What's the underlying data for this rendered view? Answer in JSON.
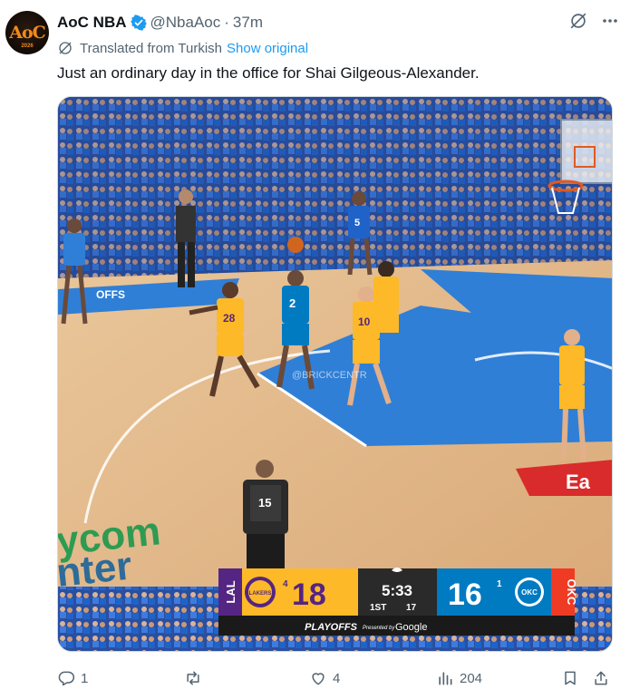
{
  "author": {
    "display_name": "AoC NBA",
    "handle": "@NbaAoc",
    "separator": "·",
    "time": "37m",
    "avatar_text": "AoC",
    "avatar_year": "2026"
  },
  "translation": {
    "label": "Translated from Turkish",
    "show_original": "Show original"
  },
  "tweet": {
    "text": "Just an ordinary day in the office for Shai Gilgeous-Alexander."
  },
  "scoreboard": {
    "away_abbr": "LAL",
    "away_timeouts": "4",
    "away_score": "18",
    "clock": "5:33",
    "period": "1ST",
    "shot_clock": "17",
    "home_score": "16",
    "home_timeouts": "1",
    "home_abbr": "OKC",
    "banner": "PLAYOFFS",
    "sponsor_prefix": "Presented by",
    "sponsor": "Google",
    "away_logo": "LAKERS",
    "home_logo": "OKC",
    "colors": {
      "away": "#552583",
      "away_gold": "#fdb927",
      "home": "#007ac1",
      "home_orange": "#ef3b24"
    }
  },
  "video_scene": {
    "watermark": "@BRICKCENTR",
    "referee_number": "15",
    "jersey_28": "28",
    "jersey_10": "10",
    "jersey_2": "2",
    "jersey_5": "5",
    "court_text_1": "ycom",
    "court_text_2": "nter",
    "court_sign": "Ea",
    "baseline_text": "OFFS"
  },
  "actions": {
    "reply_count": "1",
    "repost_count": "",
    "like_count": "4",
    "views_count": "204"
  },
  "icons": [
    "verified-badge-icon",
    "grok-icon",
    "more-icon",
    "translate-globe-icon",
    "reply-icon",
    "repost-icon",
    "like-icon",
    "views-icon",
    "bookmark-icon",
    "share-icon"
  ],
  "colors": {
    "link": "#1d9bf0",
    "secondary_text": "#536471",
    "primary_text": "#0f1419"
  }
}
